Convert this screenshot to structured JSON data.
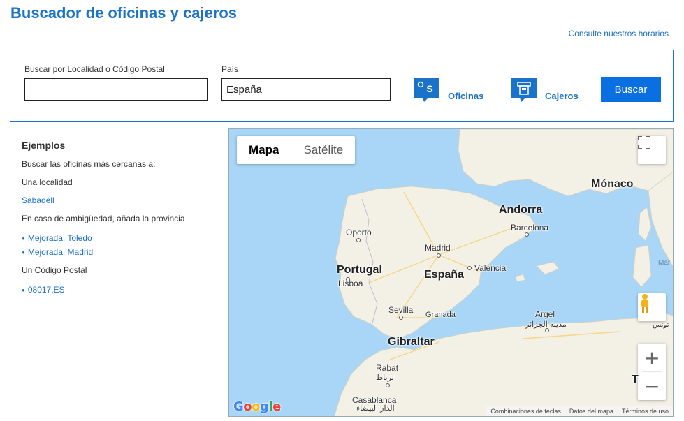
{
  "header": {
    "title": "Buscador de oficinas y cajeros",
    "schedule_link": "Consulte nuestros horarios"
  },
  "search": {
    "locality_label": "Buscar por Localidad o Código Postal",
    "locality_value": "",
    "country_label": "País",
    "country_value": "España",
    "offices_label": "Oficinas",
    "atms_label": "Cajeros",
    "button_label": "Buscar"
  },
  "examples": {
    "title": "Ejemplos",
    "intro": "Buscar las oficinas más cercanas a:",
    "locality_heading": "Una localidad",
    "locality_example": "Sabadell",
    "ambiguity_heading": "En caso de ambigüedad, añada la provincia",
    "ambiguity_examples": [
      "Mejorada, Toledo",
      "Mejorada, Madrid"
    ],
    "postal_heading": "Un Código Postal",
    "postal_example": "08017,ES"
  },
  "map": {
    "type_map": "Mapa",
    "type_satellite": "Satélite",
    "countries": {
      "spain": "España",
      "portugal": "Portugal",
      "andorra": "Andorra",
      "monaco": "Mónaco",
      "gibraltar": "Gibraltar",
      "tunisia_partial": "T"
    },
    "cities": {
      "oporto": "Oporto",
      "madrid": "Madrid",
      "barcelona": "Barcelona",
      "valencia": "Valencia",
      "lisboa": "Lisboa",
      "sevilla": "Sevilla",
      "granada": "Granada",
      "argel": "Argel",
      "argel_ar": "مدينة الجزائر",
      "rabat": "Rabat",
      "rabat_ar": "الرباط",
      "casablanca": "Casablanca",
      "casablanca_ar": "الدار البيضاء",
      "tunis_ar": "تونس"
    },
    "sea_label": "Mar",
    "google_logo": "Google",
    "attribution": [
      "Combinaciones de teclas",
      "Datos del mapa",
      "Términos de uso"
    ],
    "zoom_in": "+",
    "zoom_out": "−",
    "colors": {
      "sea": "#a9d6f6",
      "land": "#f3f0e6",
      "accent": "#1a73c9",
      "button": "#0a6fe0"
    }
  }
}
